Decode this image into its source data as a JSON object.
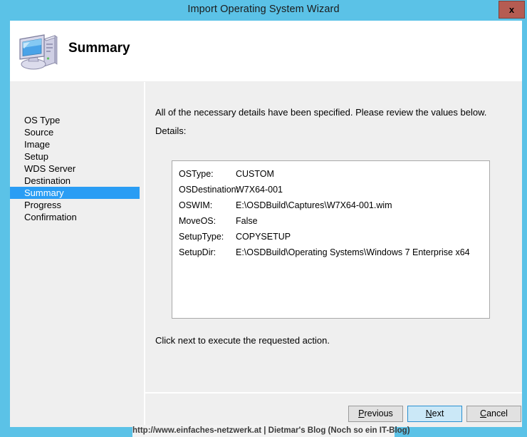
{
  "window": {
    "title": "Import Operating System Wizard",
    "close_label": "x",
    "titlebar_color": "#5bc2e7",
    "close_color": "#b55c52"
  },
  "header": {
    "title": "Summary",
    "icon": "computer-icon"
  },
  "sidebar": {
    "items": [
      {
        "label": "OS Type",
        "selected": false
      },
      {
        "label": "Source",
        "selected": false
      },
      {
        "label": "Image",
        "selected": false
      },
      {
        "label": "Setup",
        "selected": false
      },
      {
        "label": "WDS Server",
        "selected": false
      },
      {
        "label": "Destination",
        "selected": false
      },
      {
        "label": "Summary",
        "selected": true
      },
      {
        "label": "Progress",
        "selected": false
      },
      {
        "label": "Confirmation",
        "selected": false
      }
    ],
    "selected_color": "#2a9df4"
  },
  "content": {
    "intro": "All of the necessary details have been specified.  Please review the values below.",
    "details_label": "Details:",
    "details": [
      {
        "key": "OSType:",
        "value": "CUSTOM"
      },
      {
        "key": "OSDestination:",
        "value": "W7X64-001"
      },
      {
        "key": "OSWIM:",
        "value": "E:\\OSDBuild\\Captures\\W7X64-001.wim"
      },
      {
        "key": "MoveOS:",
        "value": "False"
      },
      {
        "key": "SetupType:",
        "value": "COPYSETUP"
      },
      {
        "key": "SetupDir:",
        "value": "E:\\OSDBuild\\Operating Systems\\Windows 7 Enterprise x64"
      }
    ],
    "footer_note": "Click next to execute the requested action."
  },
  "buttons": {
    "previous": {
      "prefix": "",
      "accesskey": "P",
      "suffix": "revious"
    },
    "next": {
      "prefix": "",
      "accesskey": "N",
      "suffix": "ext"
    },
    "cancel": {
      "prefix": "",
      "accesskey": "C",
      "suffix": "ancel"
    }
  },
  "watermark": {
    "text": "http://www.einfaches-netzwerk.at | Dietmar's Blog (Noch so ein IT-Blog)"
  }
}
